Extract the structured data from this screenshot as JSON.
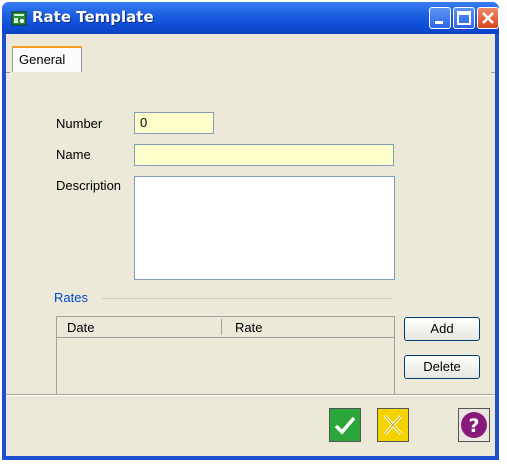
{
  "window": {
    "title": "Rate Template"
  },
  "tabs": [
    {
      "label": "General"
    }
  ],
  "form": {
    "number_label": "Number",
    "number_value": "0",
    "name_label": "Name",
    "name_value": "",
    "description_label": "Description",
    "description_value": ""
  },
  "rates": {
    "group_label": "Rates",
    "columns": [
      "Date",
      "Rate"
    ],
    "add_label": "Add",
    "delete_label": "Delete"
  },
  "footer": {
    "ok_icon": "checkmark-icon",
    "cancel_icon": "x-icon",
    "help_icon": "question-icon"
  },
  "colors": {
    "titlebar": "#1c5fe0",
    "field_bg": "#ffffcc",
    "group_label": "#0046d5",
    "ok_green": "#2aa63a",
    "cancel_yellow": "#f4d400",
    "help_purple": "#8a1a7a"
  }
}
